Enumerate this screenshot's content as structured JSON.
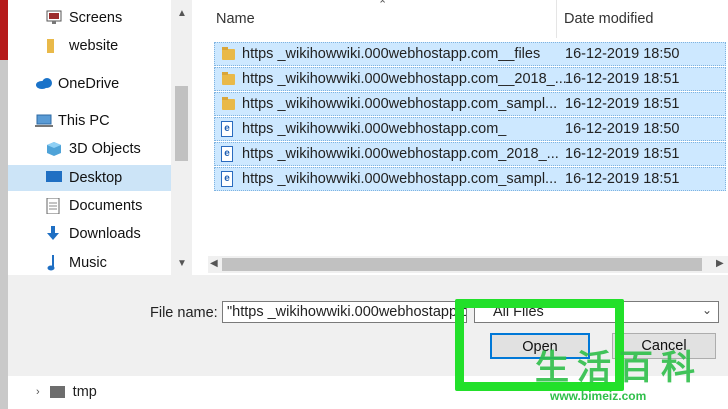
{
  "nav": {
    "items": [
      {
        "label": "Screens",
        "icon": "monitor-icon"
      },
      {
        "label": "website",
        "icon": "folder-icon"
      },
      {
        "label": "OneDrive",
        "icon": "cloud-icon"
      },
      {
        "label": "This PC",
        "icon": "computer-icon"
      },
      {
        "label": "3D Objects",
        "icon": "cube-icon"
      },
      {
        "label": "Desktop",
        "icon": "desktop-icon",
        "selected": true
      },
      {
        "label": "Documents",
        "icon": "document-icon"
      },
      {
        "label": "Downloads",
        "icon": "download-icon"
      },
      {
        "label": "Music",
        "icon": "music-icon"
      }
    ]
  },
  "list": {
    "columns": {
      "name": "Name",
      "date": "Date modified"
    },
    "rows": [
      {
        "name": "https _wikihowwiki.000webhostapp.com__files",
        "date": "16-12-2019 18:50",
        "type": "folder"
      },
      {
        "name": "https _wikihowwiki.000webhostapp.com__2018_...",
        "date": "16-12-2019 18:51",
        "type": "folder"
      },
      {
        "name": "https _wikihowwiki.000webhostapp.com_sampl...",
        "date": "16-12-2019 18:51",
        "type": "folder"
      },
      {
        "name": "https _wikihowwiki.000webhostapp.com_",
        "date": "16-12-2019 18:50",
        "type": "html"
      },
      {
        "name": "https _wikihowwiki.000webhostapp.com_2018_...",
        "date": "16-12-2019 18:51",
        "type": "html"
      },
      {
        "name": "https _wikihowwiki.000webhostapp.com_sampl...",
        "date": "16-12-2019 18:51",
        "type": "html"
      }
    ]
  },
  "bottom": {
    "file_name_label": "File name:",
    "file_name_value": "\"https _wikihowwiki.000webhostapp.c",
    "filter_value": "All Files",
    "open_label": "Open",
    "cancel_label": "Cancel"
  },
  "background": {
    "folder_label": "tmp"
  },
  "watermark": {
    "text": "生活百科",
    "url": "www.bimeiz.com"
  },
  "colors": {
    "selection": "#cde8ff",
    "highlight": "#22e02a",
    "accent": "#0078d7"
  }
}
